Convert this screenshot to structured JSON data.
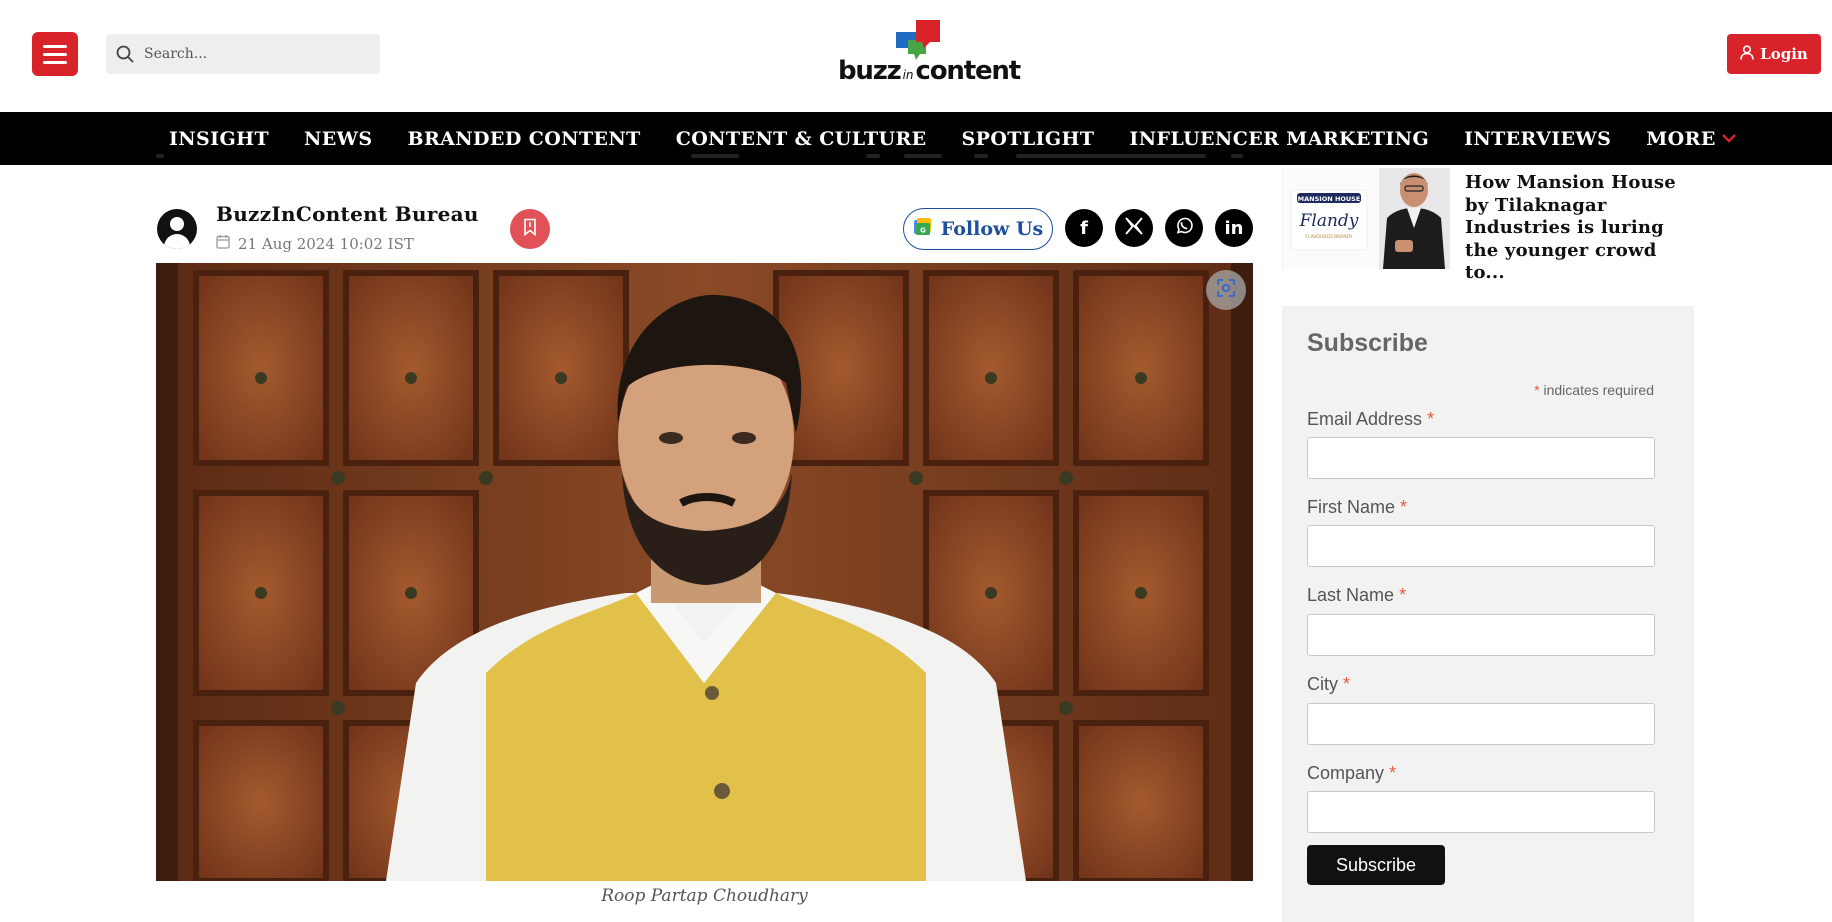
{
  "header": {
    "search_placeholder": "Search...",
    "logo": {
      "word1": "buzz",
      "word2": "in",
      "word3": "content"
    },
    "login_label": "Login"
  },
  "nav": {
    "items": [
      "INSIGHT",
      "NEWS",
      "BRANDED CONTENT",
      "CONTENT & CULTURE",
      "SPOTLIGHT",
      "INFLUENCER MARKETING",
      "INTERVIEWS",
      "MORE"
    ]
  },
  "article": {
    "author": "BuzzInContent Bureau",
    "date": "21 Aug 2024 10:02 IST",
    "follow_label": "Follow Us",
    "social": [
      "facebook",
      "x",
      "whatsapp",
      "linkedin"
    ],
    "image_caption": "Roop Partap Choudhary"
  },
  "sidebar": {
    "related_title": "How Mansion House by Tilaknagar Industries is luring the younger crowd to...",
    "thumb_brand": "MANSION HOUSE",
    "thumb_product": "Flandy",
    "thumb_sub": "FLAVOURED BRANDY"
  },
  "subscribe": {
    "title": "Subscribe",
    "required_note": "indicates required",
    "fields": [
      {
        "label": "Email Address",
        "value": ""
      },
      {
        "label": "First Name",
        "value": ""
      },
      {
        "label": "Last Name",
        "value": ""
      },
      {
        "label": "City",
        "value": ""
      },
      {
        "label": "Company",
        "value": ""
      }
    ],
    "button_label": "Subscribe"
  },
  "colors": {
    "brand_red": "#d8232a",
    "nav_bg": "#000000",
    "follow_blue": "#1e4f9b"
  }
}
